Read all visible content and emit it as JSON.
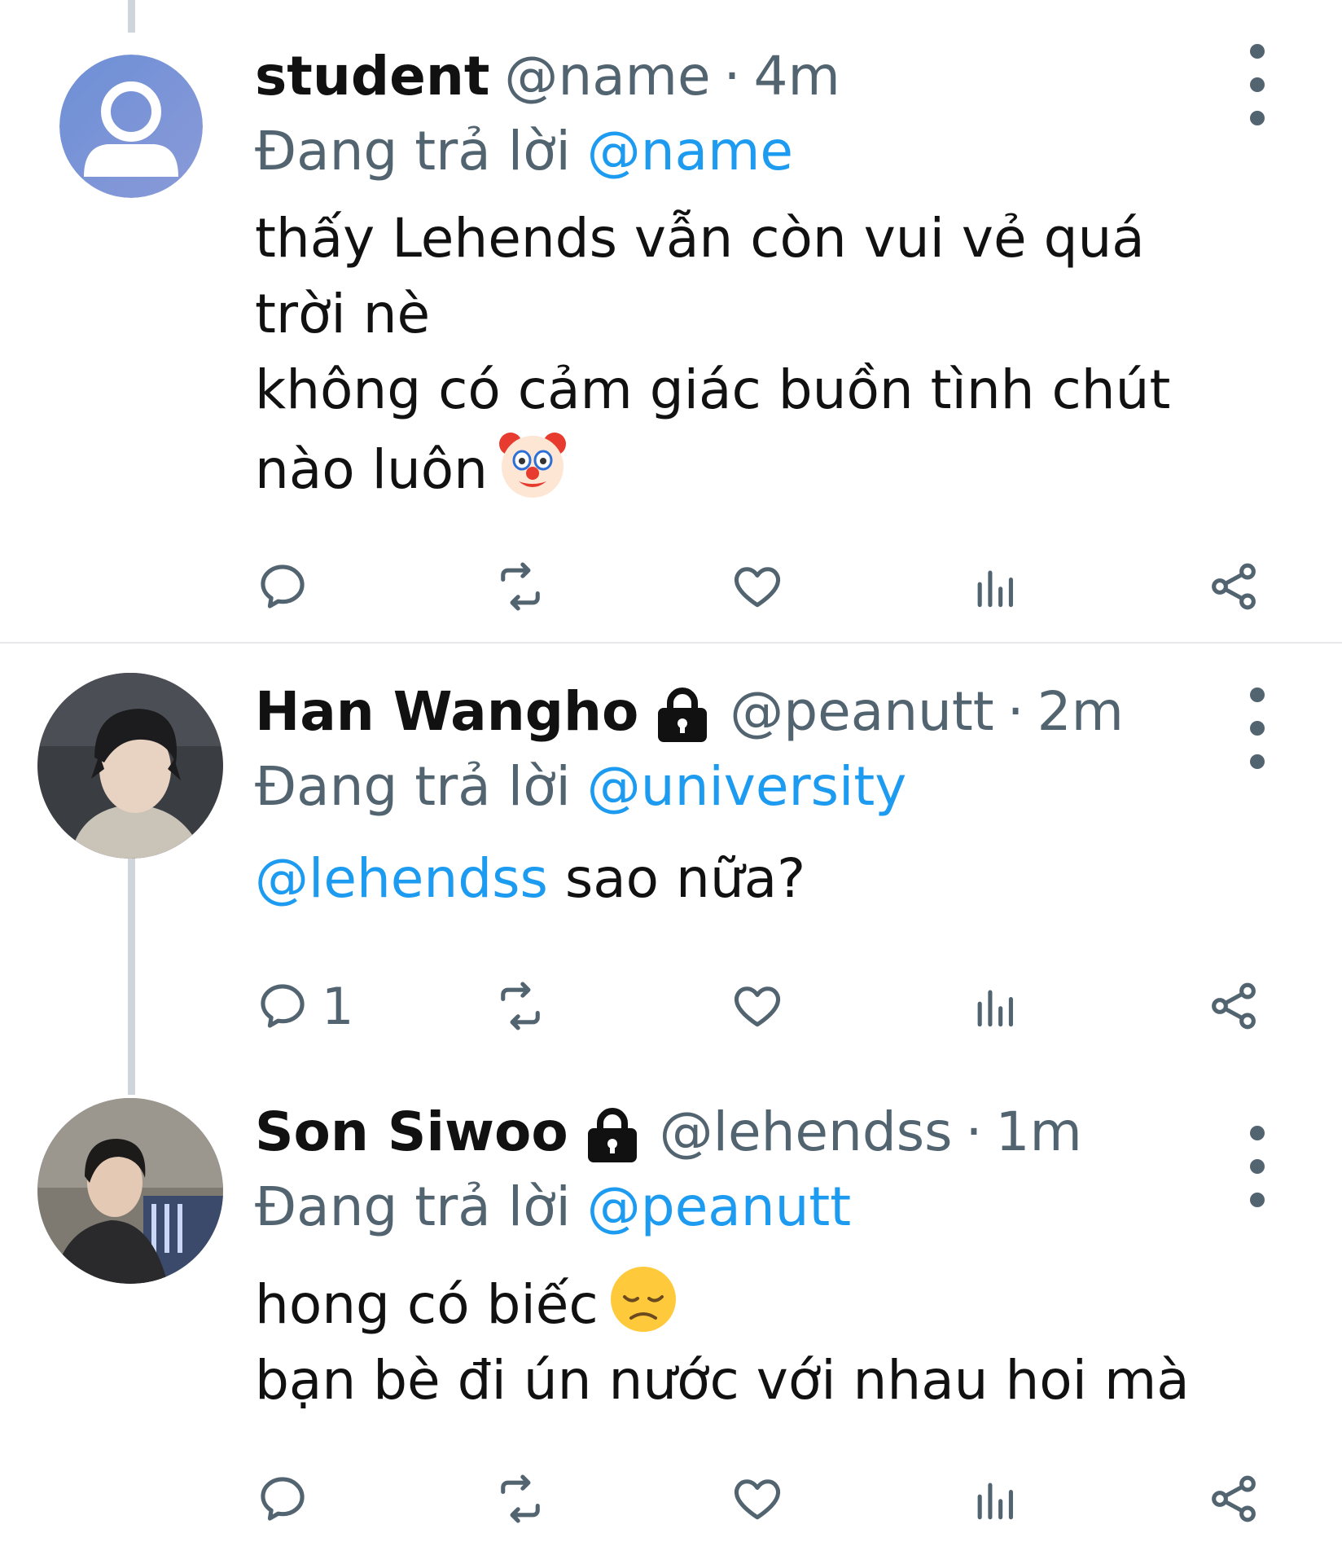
{
  "tweets": [
    {
      "display_name": "student",
      "handle": "@name",
      "separator": "·",
      "time": "4m",
      "locked": false,
      "reply_label": "Đang trả lời",
      "reply_to": "@name",
      "body_lines": [
        "thấy Lehends vẫn còn vui vẻ quá",
        "trời nè",
        "không có cảm giác buồn tình chút",
        "nào luôn"
      ],
      "body_emoji": "clown-face",
      "reply_count": ""
    },
    {
      "display_name": "Han Wangho",
      "handle": "@peanutt",
      "separator": "·",
      "time": "2m",
      "locked": true,
      "reply_label": "Đang trả lời",
      "reply_to": "@university",
      "body_mention": "@lehendss",
      "body_text": " sao nữa?",
      "reply_count": "1"
    },
    {
      "display_name": "Son Siwoo",
      "handle": "@lehendss",
      "separator": "·",
      "time": "1m",
      "locked": true,
      "reply_label": "Đang trả lời",
      "reply_to": "@peanutt",
      "body_lines": [
        "hong có biếc",
        "bạn bè đi ún nước với nhau hoi mà"
      ],
      "body_emoji": "disappointed-face",
      "reply_count": ""
    }
  ],
  "icons": {
    "reply": "reply-icon",
    "retweet": "retweet-icon",
    "like": "heart-icon",
    "views": "views-icon",
    "share": "share-icon",
    "more": "more-options-icon",
    "lock": "lock-icon"
  },
  "colors": {
    "link": "#1d9bf0",
    "secondary_text": "#536471",
    "thread_line": "#cfd5da",
    "divider": "#e6e8eb"
  }
}
